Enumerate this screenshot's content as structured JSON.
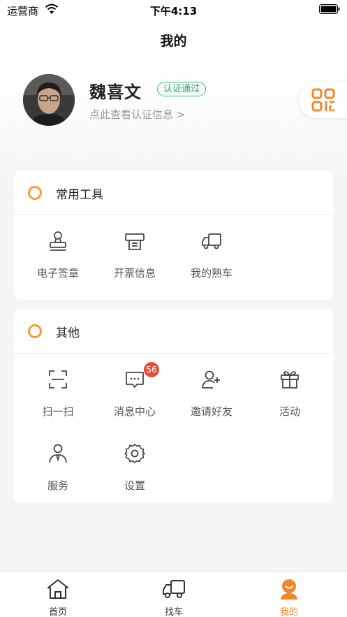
{
  "status_bar": {
    "carrier": "运营商",
    "time": "下午4:13"
  },
  "nav": {
    "title": "我的"
  },
  "profile": {
    "name": "魏喜文",
    "cert_badge": "认证通过",
    "cert_link": "点此查看认证信息 >"
  },
  "tools_section": {
    "title": "常用工具",
    "items": [
      {
        "label": "电子签章",
        "icon": "stamp-icon"
      },
      {
        "label": "开票信息",
        "icon": "invoice-icon"
      },
      {
        "label": "我的熟车",
        "icon": "truck-icon"
      }
    ]
  },
  "other_section": {
    "title": "其他",
    "items": [
      {
        "label": "扫一扫",
        "icon": "scan-icon"
      },
      {
        "label": "消息中心",
        "icon": "message-icon",
        "badge": "56"
      },
      {
        "label": "邀请好友",
        "icon": "add-user-icon"
      },
      {
        "label": "活动",
        "icon": "gift-icon"
      },
      {
        "label": "服务",
        "icon": "service-icon"
      },
      {
        "label": "设置",
        "icon": "gear-icon"
      }
    ]
  },
  "tab_bar": {
    "tabs": [
      {
        "label": "首页",
        "icon": "home-icon"
      },
      {
        "label": "找车",
        "icon": "truck-icon"
      },
      {
        "label": "我的",
        "icon": "profile-icon",
        "active": true
      }
    ]
  },
  "colors": {
    "accent": "#f2872a",
    "cert_green": "#3aa86a",
    "badge_red": "#e84c3d",
    "section_dot": "#f5a033"
  }
}
